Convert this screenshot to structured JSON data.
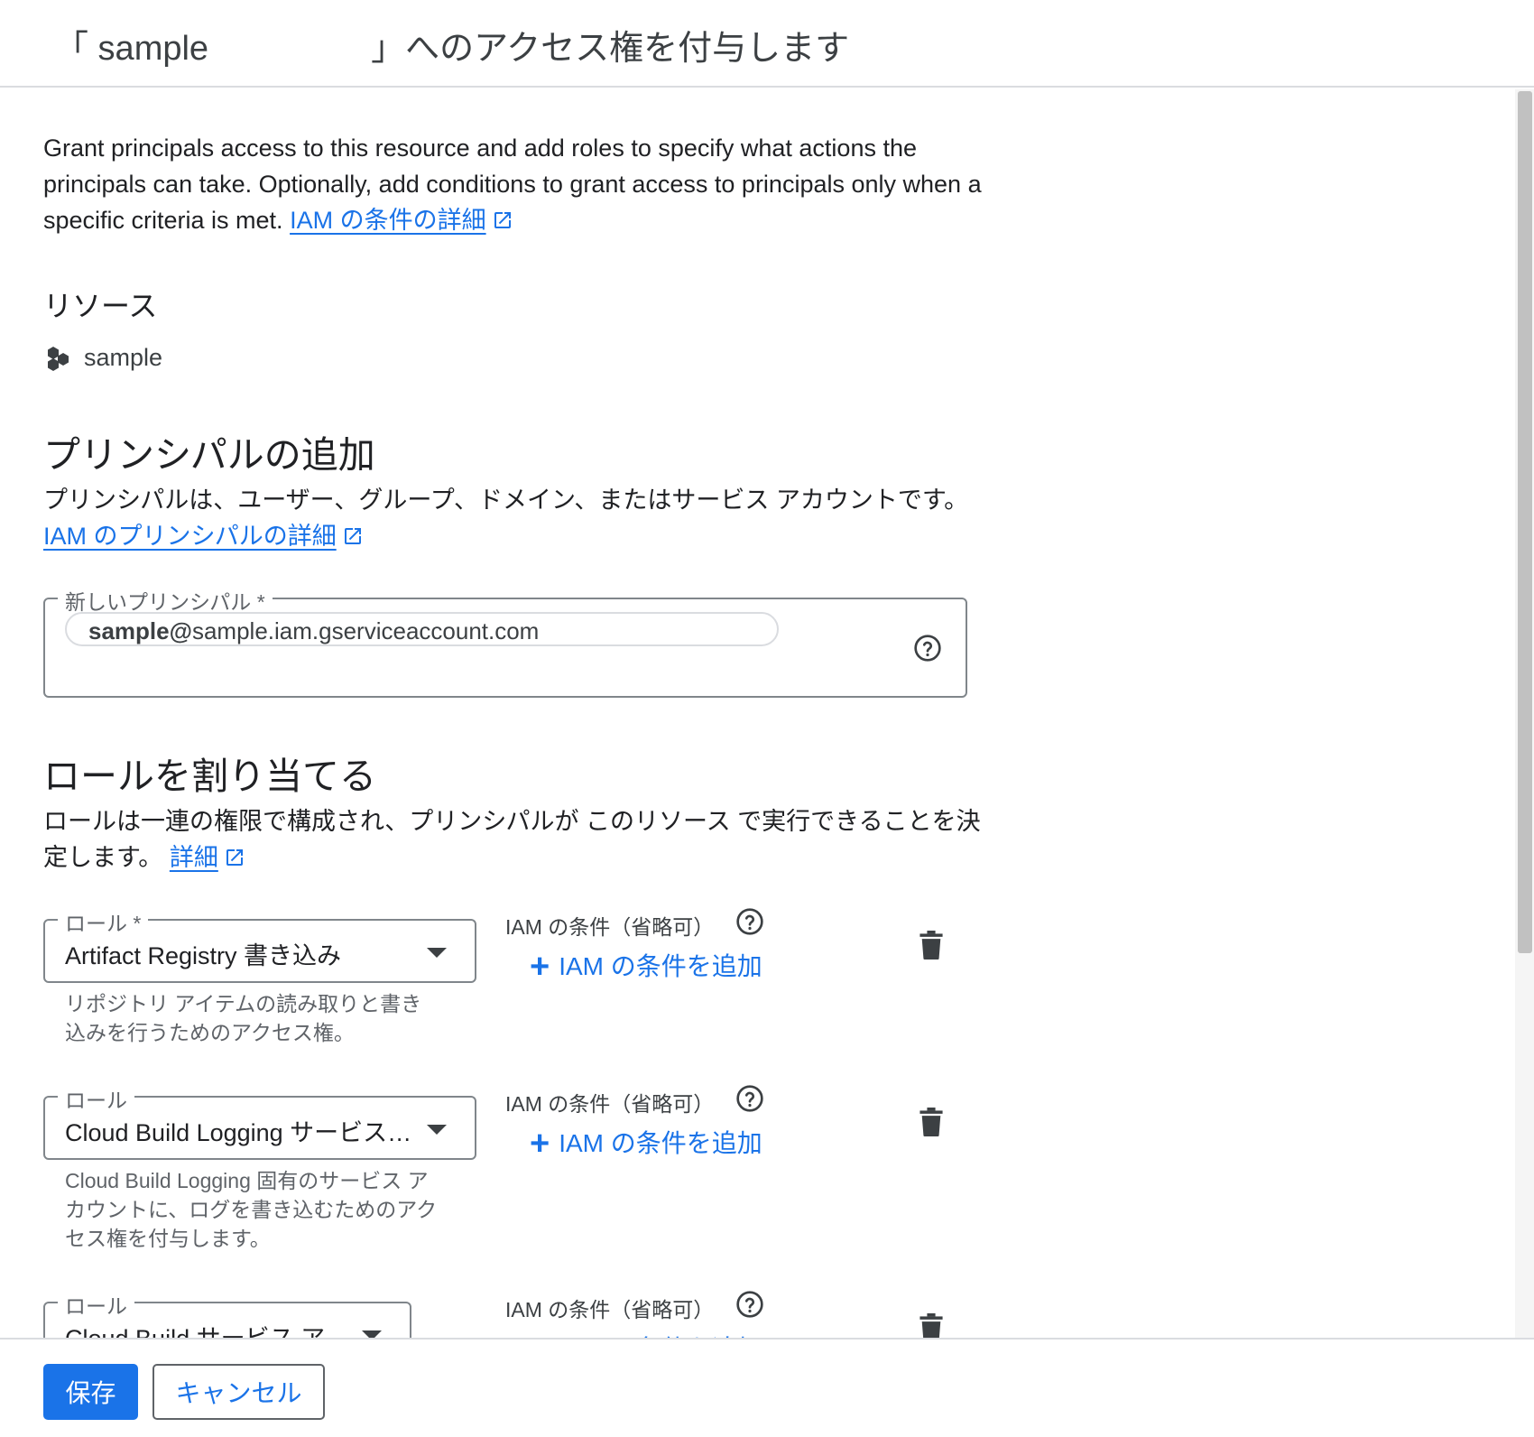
{
  "header": {
    "title_open": "「 sample",
    "title_close": "」へのアクセス権を付与します"
  },
  "intro": {
    "text": "Grant principals access to this resource and add roles to specify what actions the principals can take. Optionally, add conditions to grant access to principals only when a specific criteria is met.",
    "link": "IAM の条件の詳細"
  },
  "resource": {
    "heading": "リソース",
    "name": "sample"
  },
  "principals": {
    "heading": "プリンシパルの追加",
    "description": "プリンシパルは、ユーザー、グループ、ドメイン、またはサービス アカウントです。",
    "link": "IAM のプリンシパルの詳細",
    "field_label": "新しいプリンシパル *",
    "chip_bold": "sample@",
    "chip_rest": "sample.iam.gserviceaccount.com"
  },
  "roles": {
    "heading": "ロールを割り当てる",
    "description": "ロールは一連の権限で構成され、プリンシパルが このリソース で実行できることを決定します。",
    "link": "詳細",
    "condition_label": "IAM の条件（省略可）",
    "add_condition": "IAM の条件を追加",
    "items": [
      {
        "label": "ロール *",
        "value": "Artifact Registry 書き込み",
        "description": "リポジトリ アイテムの読み取りと書き込みを行うためのアクセス権。"
      },
      {
        "label": "ロール",
        "value": "Cloud Build Logging サービス…",
        "description": "Cloud Build Logging 固有のサービス アカウントに、ログを書き込むためのアクセス権を付与します。"
      },
      {
        "label": "ロール",
        "value": "Cloud Build サービス ア",
        "description": ""
      }
    ]
  },
  "footer": {
    "save": "保存",
    "cancel": "キャンセル"
  },
  "colors": {
    "accent": "#1a73e8",
    "text": "#202124",
    "muted": "#5f6368",
    "border": "#80868b"
  }
}
